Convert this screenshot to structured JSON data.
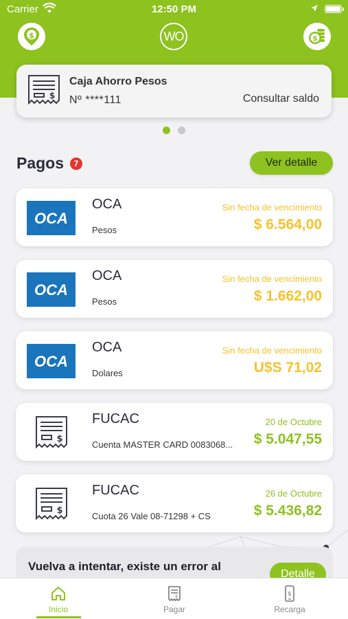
{
  "status_bar": {
    "carrier": "Carrier",
    "time": "12:50 PM"
  },
  "header": {
    "logo_text": "WO",
    "left_icon": "location-money-icon",
    "right_icon": "coins-icon"
  },
  "account": {
    "name": "Caja Ahorro Pesos",
    "number": "Nº ****111",
    "action": "Consultar saldo"
  },
  "carousel": {
    "pages": 2,
    "active": 1
  },
  "payments": {
    "title": "Pagos",
    "badge": "7",
    "detail_button": "Ver detalle",
    "items": [
      {
        "title": "OCA",
        "subtitle": "Pesos",
        "due": "Sin fecha de vencimiento",
        "amount": "$ 6.564,00",
        "status": "orange"
      },
      {
        "title": "OCA",
        "subtitle": "Pesos",
        "due": "Sin fecha de vencimiento",
        "amount": "$ 1.662,00",
        "status": "orange"
      },
      {
        "title": "OCA",
        "subtitle": "Dolares",
        "due": "Sin fecha de vencimiento",
        "amount": "U$S 71,02",
        "status": "orange"
      },
      {
        "title": "FUCAC",
        "subtitle": "Cuenta MASTER CARD 0083068...",
        "due": "20 de Octubre",
        "amount": "$ 5.047,55",
        "status": "green"
      },
      {
        "title": "FUCAC",
        "subtitle": "Cuota 26 Vale 08-71298 + CS",
        "due": "26 de Octubre",
        "amount": "$ 5.436,82",
        "status": "green"
      }
    ],
    "oca_logo_text": "OCA"
  },
  "error": {
    "message": "Vuelva a intentar, existe un error al",
    "button": "Detalle"
  },
  "tabbar": {
    "tabs": [
      {
        "label": "Inicio",
        "icon": "home-icon"
      },
      {
        "label": "Pagar",
        "icon": "bill-icon"
      },
      {
        "label": "Recarga",
        "icon": "phone-recharge-icon"
      }
    ]
  },
  "colors": {
    "brand_green": "#8dc21f",
    "amount_orange": "#f7c229",
    "oca_blue": "#1b75bc",
    "badge_red": "#e3342f"
  }
}
